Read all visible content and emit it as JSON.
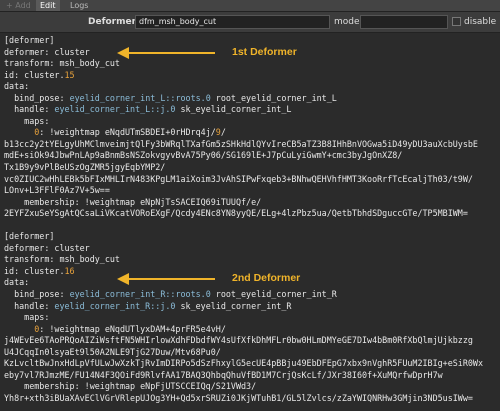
{
  "tabs": [
    {
      "label": "+ Add",
      "state": "disabled"
    },
    {
      "label": "Edit",
      "state": "active"
    },
    {
      "label": "Logs",
      "state": "normal"
    }
  ],
  "toolbar": {
    "deformer_label": "Deformer",
    "deformer_value": "dfm_msh_body_cut",
    "mode_label": "mode",
    "disable_label": "disable"
  },
  "annotations": {
    "first": "1st Deformer",
    "second": "2nd Deformer",
    "color": "#f0b42a"
  },
  "lines": [
    [
      [
        "b",
        "[deformer]"
      ]
    ],
    [
      [
        "k",
        "deformer: cluster"
      ]
    ],
    [
      [
        "k",
        "transform: msh_body_cut"
      ]
    ],
    [
      [
        "k",
        "id: cluster."
      ],
      [
        "n",
        "15"
      ]
    ],
    [
      [
        "k",
        "data:"
      ]
    ],
    [
      [
        "k",
        "  bind_pose: "
      ],
      [
        "s",
        "eyelid_corner_int_L::roots.0"
      ],
      [
        "k",
        " root_eyelid_corner_int_L"
      ]
    ],
    [
      [
        "k",
        "  handle: "
      ],
      [
        "s",
        "eyelid_corner_int_L::j.0"
      ],
      [
        "k",
        " sk_eyelid_corner_int_L"
      ]
    ],
    [
      [
        "k",
        "    maps:"
      ]
    ],
    [
      [
        "n",
        "      0"
      ],
      [
        "k",
        ": !weightmap eNqdUTmSBDEI+0rHDrq4j/"
      ],
      [
        "n",
        "9"
      ],
      [
        "k",
        "/"
      ]
    ],
    [
      [
        "k",
        "b13cc2y2tYELgyUhMClmveimjtQlFy3bWRqlTXafGm5zSHkHdlQYvIreCB5aTZ3B8IHhBnVOGwa5iD49yDU3auXcbUysbE"
      ]
    ],
    [
      [
        "k",
        "mdE+siOk94JbwPnLAp9aBnmBsNSZokvgyvBvA75Py06/SG169lE+J7pCuLyiGwmY+cmc3byJgOnXZ8/"
      ]
    ],
    [
      [
        "k",
        "Tx1B9y9vPlBeUSzOgZMR5jgyEqbYMP2/"
      ]
    ],
    [
      [
        "k",
        "vc0ZIUC2wHhLEBk5bFIxMHLIrN483KPgLM1aiXoim3JvAhSIPwFxqeb3+BNhwQEHVhfHMT3KooRrfTcEcaljTh03/t9W/"
      ]
    ],
    [
      [
        "k",
        "LOnv+L3FFlF0Az7V+5w=="
      ]
    ],
    [
      [
        "k",
        "    membership: !weightmap eNpNjTsSACEIQ69iTUUQf/e/"
      ]
    ],
    [
      [
        "k",
        "2EYFZxuSeYSgAtQCsaLiVKcatVORoEXgF/Qcdy4ENc8YN8yyQE/ELg+4lzPbz5ua/QetbTbhdSDguccGTe/TP5MBIWM="
      ]
    ],
    [
      [
        "k",
        ""
      ]
    ],
    [
      [
        "b",
        "[deformer]"
      ]
    ],
    [
      [
        "k",
        "deformer: cluster"
      ]
    ],
    [
      [
        "k",
        "transform: msh_body_cut"
      ]
    ],
    [
      [
        "k",
        "id: cluster."
      ],
      [
        "n",
        "16"
      ]
    ],
    [
      [
        "k",
        "data:"
      ]
    ],
    [
      [
        "k",
        "  bind_pose: "
      ],
      [
        "s",
        "eyelid_corner_int_R::roots.0"
      ],
      [
        "k",
        " root_eyelid_corner_int_R"
      ]
    ],
    [
      [
        "k",
        "  handle: "
      ],
      [
        "s",
        "eyelid_corner_int_R::j.0"
      ],
      [
        "k",
        " sk_eyelid_corner_int_R"
      ]
    ],
    [
      [
        "k",
        "    maps:"
      ]
    ],
    [
      [
        "n",
        "      0"
      ],
      [
        "k",
        ": !weightmap eNqdUTlyxDAM+4prFR5e4vH/"
      ]
    ],
    [
      [
        "k",
        "j4WEvEe6TAoPRQoAIZiWsftFN5WHIrlowXdhFDbdfWY4sUfXfkDhMFLr0bw0HLmDMYeGE7DIw4bBm0RfXbQlmjUjkbzzg"
      ]
    ],
    [
      [
        "k",
        "U4JCqqIn0lsyaEt9l50A2NLE9TjG27Duw/Mtv68Pu0/"
      ]
    ],
    [
      [
        "k",
        "KzLvcltBwJnxHdLpVfULwJwXzkTjRvImDIRPo5dSzFhxylG5ecUE4pBBju49EbDFEpG7xbx9nVghR5FUuM2IBIg+eSiR0Wx"
      ]
    ],
    [
      [
        "k",
        "eby7vl7RJmzME/FU14N4F3QOiFd9RlvfAA17BAQ3QhbqQhuVfBD1M7CrjQsKcLf/JXr38I60f+XuMQrfwDprH7w"
      ]
    ],
    [
      [
        "k",
        "    membership: !weightmap eNpFjUTSCCEIQq/S21VWd3/"
      ]
    ],
    [
      [
        "k",
        "Yh8r+xth3iBUaXAvEClVGrVRlepUJOg3YH+Qd5xrSRUZi0JKjWTuhB1/GL5lZvlcs/zZaYWIQNRHw3GMjin3ND5usIWw="
      ]
    ]
  ]
}
